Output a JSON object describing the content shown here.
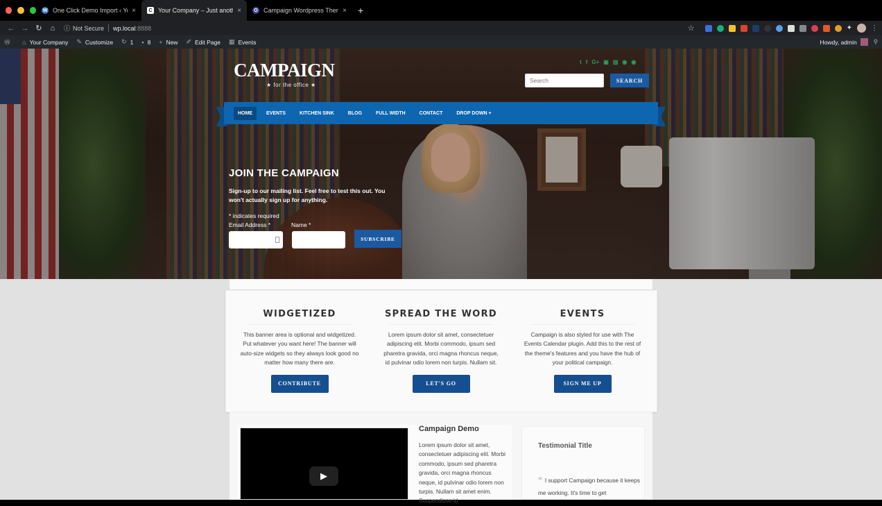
{
  "browser": {
    "tabs": [
      {
        "title": "One Click Demo Import ‹ Your",
        "favicon": "wordpress-icon",
        "active": false
      },
      {
        "title": "Your Company – Just another",
        "favicon": "campaign-c-icon",
        "active": true
      },
      {
        "title": "Campaign Wordpress Theme",
        "favicon": "theme-icon",
        "active": false
      }
    ],
    "address": {
      "security": "Not Secure",
      "host": "wp.local",
      "port": ":8888"
    },
    "close_glyph": "×",
    "newtab_glyph": "+"
  },
  "wp_admin_bar": {
    "site_name": "Your Company",
    "customize": "Customize",
    "updates": "1",
    "comments": "8",
    "new": "New",
    "edit_page": "Edit Page",
    "events": "Events",
    "greeting": "Howdy, admin"
  },
  "header": {
    "logo": "CAMPAIGN",
    "tagline": "★ for the office ★",
    "social": [
      "twitter",
      "facebook",
      "google-plus",
      "flickr",
      "youtube",
      "instagram",
      "rss"
    ],
    "social_glyphs": [
      "t",
      "f",
      "G+",
      "▣",
      "▥",
      "◉",
      "◉"
    ],
    "search_placeholder": "Search",
    "search_button": "SEARCH"
  },
  "nav": {
    "items": [
      {
        "label": "HOME",
        "active": true
      },
      {
        "label": "EVENTS",
        "active": false
      },
      {
        "label": "KITCHEN SINK",
        "active": false
      },
      {
        "label": "BLOG",
        "active": false
      },
      {
        "label": "FULL WIDTH",
        "active": false
      },
      {
        "label": "CONTACT",
        "active": false
      },
      {
        "label": "DROP DOWN +",
        "active": false
      }
    ]
  },
  "signup": {
    "title": "JOIN THE CAMPAIGN",
    "text": "Sign-up to our mailing list. Feel free to test this out. You won't actually sign up for anything.",
    "required_note": "* indicates required",
    "email_label": "Email Address *",
    "email_value": "",
    "name_label": "Name *",
    "name_value": "",
    "subscribe_button": "SUBSCRIBE"
  },
  "widgets": [
    {
      "title": "WIDGETIZED",
      "text": "This banner area is optional and widgetized. Put whatever you want here! The banner will auto-size widgets so they always look good no matter how many there are.",
      "button": "CONTRIBUTE"
    },
    {
      "title": "SPREAD THE WORD",
      "text": "Lorem ipsum dolor sit amet, consectetuer adipiscing elit. Morbi commodo, ipsum sed pharetra gravida, orci magna rhoncus neque, id pulvinar odio lorem non turpis. Nullam sit.",
      "button": "LET'S GO"
    },
    {
      "title": "EVENTS",
      "text": "Campaign is also styled for use with The Events Calendar plugin. Add this to the rest of the theme's features and you have the hub of your political campaign.",
      "button": "SIGN ME UP"
    }
  ],
  "demo": {
    "title": "Campaign Demo",
    "text": "Lorem ipsum dolor sit amet, consectetuer adipiscing elit. Morbi commodo, ipsum sed pharetra gravida, orci magna rhoncus neque, id pulvinar odio lorem non turpis. Nullam sit amet enim. Suspendisse id"
  },
  "testimonial": {
    "title": "Testimonial Title",
    "quote": "I support Campaign because it keeps me working. It's time to get"
  },
  "colors": {
    "nav_blue": "#0e66b0",
    "button_blue": "#1b5aa0",
    "social_green": "#2e9e5e",
    "wp_bar": "#23282d"
  }
}
